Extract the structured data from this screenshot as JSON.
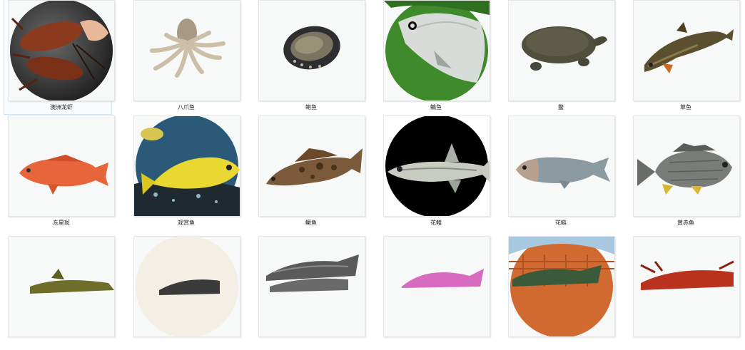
{
  "items": [
    {
      "label": "澳洲龙虾",
      "icon": "lobster-thumbnail"
    },
    {
      "label": "八爪鱼",
      "icon": "octopus-thumbnail"
    },
    {
      "label": "鲍鱼",
      "icon": "abalone-thumbnail"
    },
    {
      "label": "鳊鱼",
      "icon": "bream-thumbnail"
    },
    {
      "label": "鳖",
      "icon": "softshell-turtle-thumbnail"
    },
    {
      "label": "草鱼",
      "icon": "grass-carp-thumbnail"
    },
    {
      "label": "东星斑",
      "icon": "coral-grouper-thumbnail"
    },
    {
      "label": "观赏鱼",
      "icon": "ornamental-fish-thumbnail"
    },
    {
      "label": "鳜鱼",
      "icon": "mandarin-fish-thumbnail"
    },
    {
      "label": "花鳍",
      "icon": "minnow-thumbnail"
    },
    {
      "label": "花鲢",
      "icon": "bighead-carp-thumbnail"
    },
    {
      "label": "黄赤鱼",
      "icon": "yellowfin-bream-thumbnail"
    },
    {
      "label": "",
      "icon": "catfish-thumbnail"
    },
    {
      "label": "",
      "icon": "fish-thumbnail"
    },
    {
      "label": "",
      "icon": "croaker-thumbnail"
    },
    {
      "label": "",
      "icon": "pink-fish-thumbnail"
    },
    {
      "label": "",
      "icon": "tilapia-basket-thumbnail"
    },
    {
      "label": "",
      "icon": "crayfish-thumbnail"
    }
  ]
}
